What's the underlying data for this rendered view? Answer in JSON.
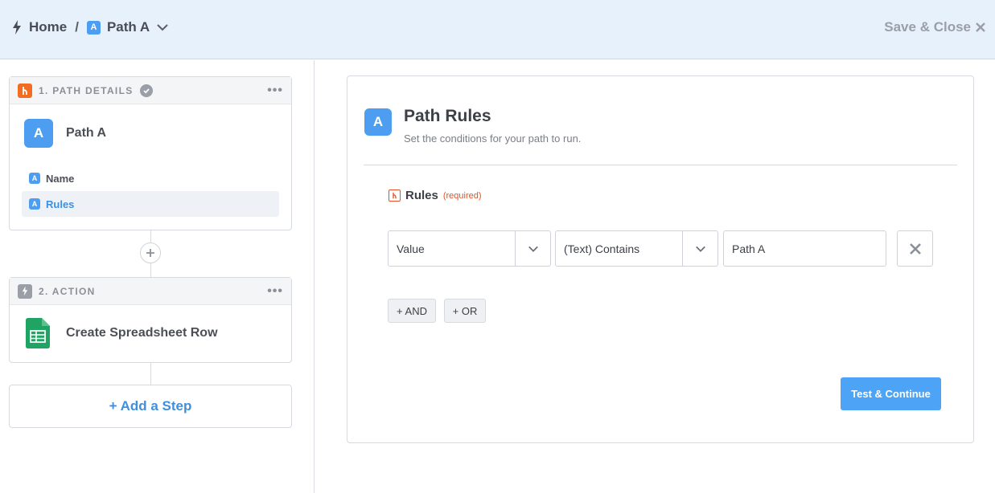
{
  "header": {
    "home_label": "Home",
    "separator": "/",
    "path_badge": "A",
    "path_label": "Path A",
    "save_close_label": "Save & Close"
  },
  "steps": {
    "path_details": {
      "header_label": "1. PATH DETAILS",
      "more": "•••",
      "badge": "A",
      "title": "Path A",
      "items": [
        {
          "badge": "A",
          "label": "Name"
        },
        {
          "badge": "A",
          "label": "Rules"
        }
      ]
    },
    "action": {
      "header_label": "2. ACTION",
      "more": "•••",
      "title": "Create Spreadsheet Row"
    },
    "add_step_label": "+ Add a Step"
  },
  "panel": {
    "badge": "A",
    "title": "Path Rules",
    "subtitle": "Set the conditions for your path to run.",
    "rules_label": "Rules",
    "rules_required": "(required)",
    "field_select": "Value",
    "operator_select": "(Text) Contains",
    "value_input": "Path A",
    "and_label": "+ AND",
    "or_label": "+ OR",
    "submit_label": "Test & Continue"
  },
  "colors": {
    "accent": "#4d9ef0",
    "header_bg": "#e6f1fc",
    "path_orange": "#f26c21",
    "sheets_green": "#1fa463",
    "required_red": "#e8501f"
  }
}
